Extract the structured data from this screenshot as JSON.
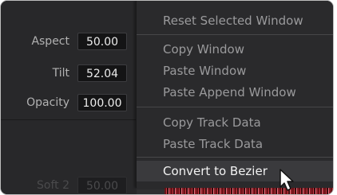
{
  "params": [
    {
      "label": "Aspect",
      "value": "50.00"
    },
    {
      "label": "Tilt",
      "value": "52.04"
    },
    {
      "label": "Opacity",
      "value": "100.00"
    }
  ],
  "dimmed_param": {
    "label": "Soft 2",
    "value": "50.00"
  },
  "menu": {
    "items": [
      {
        "label": "Reset Selected Window"
      },
      {
        "label": "Copy Window"
      },
      {
        "label": "Paste Window"
      },
      {
        "label": "Paste Append Window"
      },
      {
        "label": "Copy Track Data"
      },
      {
        "label": "Paste Track Data"
      },
      {
        "label": "Convert to Bezier",
        "highlighted": true
      }
    ]
  },
  "colors": {
    "panel": "#28282a",
    "menu": "#2a2a2c",
    "highlight": "#3a3a3d",
    "waveform": "#c73a46"
  },
  "cursor_icon": "mouse-pointer-icon"
}
